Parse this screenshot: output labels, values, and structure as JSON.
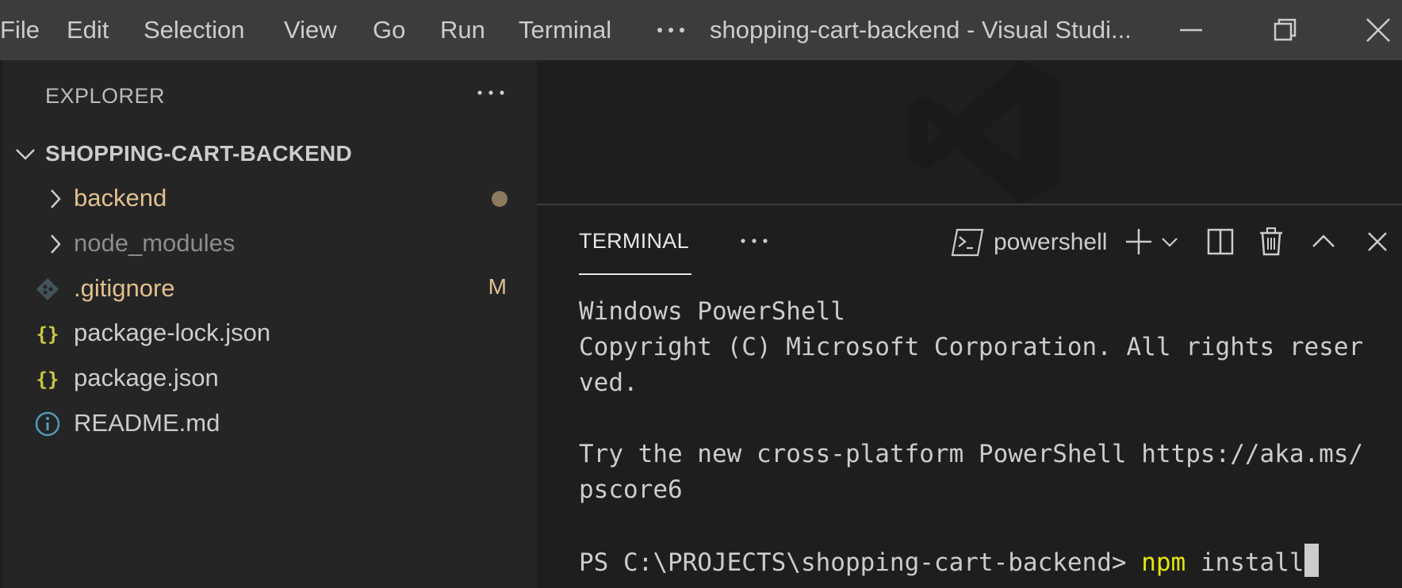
{
  "menu": [
    "File",
    "Edit",
    "Selection",
    "View",
    "Go",
    "Run",
    "Terminal"
  ],
  "window_title": "shopping-cart-backend - Visual Studi...",
  "sidebar": {
    "title": "EXPLORER",
    "project": "SHOPPING-CART-BACKEND",
    "items": [
      {
        "label": "backend",
        "kind": "folder",
        "color": "#e2c08d",
        "badge": ""
      },
      {
        "label": "node_modules",
        "kind": "folder",
        "color": "#8c8c8c",
        "badge": ""
      },
      {
        "label": ".gitignore",
        "kind": "git",
        "color": "#e2c08d",
        "badge": "M"
      },
      {
        "label": "package-lock.json",
        "kind": "json",
        "color": "#cccccc",
        "badge": ""
      },
      {
        "label": "package.json",
        "kind": "json",
        "color": "#cccccc",
        "badge": ""
      },
      {
        "label": "README.md",
        "kind": "info",
        "color": "#cccccc",
        "badge": ""
      }
    ]
  },
  "panel": {
    "tab": "TERMINAL",
    "shell": "powershell"
  },
  "terminal": {
    "line1": "Windows PowerShell",
    "line2": "Copyright (C) Microsoft Corporation. All rights reser",
    "line3": "ved.",
    "line5": "Try the new cross-platform PowerShell https://aka.ms/",
    "line6": "pscore6",
    "prompt": "PS C:\\PROJECTS\\shopping-cart-backend> ",
    "command": "npm",
    "args": " install"
  },
  "colors": {
    "titlebar": "#3c3c3c",
    "sidebar": "#252526",
    "editor": "#1e1e1e",
    "modified": "#e2c08d",
    "json_icon": "#cbcb41",
    "info_icon": "#519aba",
    "command": "#e5e510"
  }
}
